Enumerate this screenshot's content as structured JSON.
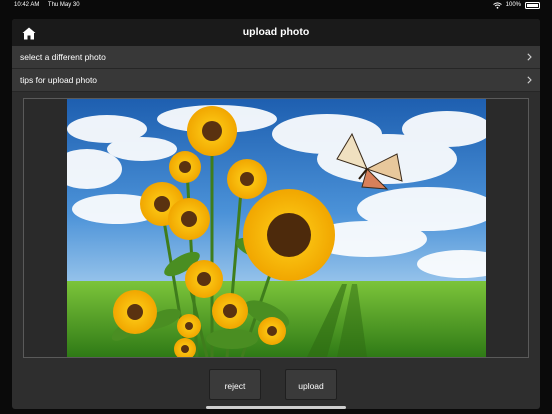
{
  "status_bar": {
    "time": "10:42 AM",
    "date": "Thu May 30",
    "battery_text": "100%"
  },
  "nav": {
    "title": "upload photo",
    "home_icon": "home-icon"
  },
  "menu": {
    "items": [
      {
        "label": "select a different photo",
        "icon": "chevron-right-icon"
      },
      {
        "label": "tips for upload photo",
        "icon": "chevron-right-icon"
      }
    ]
  },
  "actions": {
    "reject_label": "reject",
    "upload_label": "upload"
  },
  "colors": {
    "background": "#0a0a0a",
    "panel": "#2e2e2e",
    "nav_bar": "#1a1a1a",
    "menu_row": "#383838",
    "button": "#3a3a3a"
  }
}
